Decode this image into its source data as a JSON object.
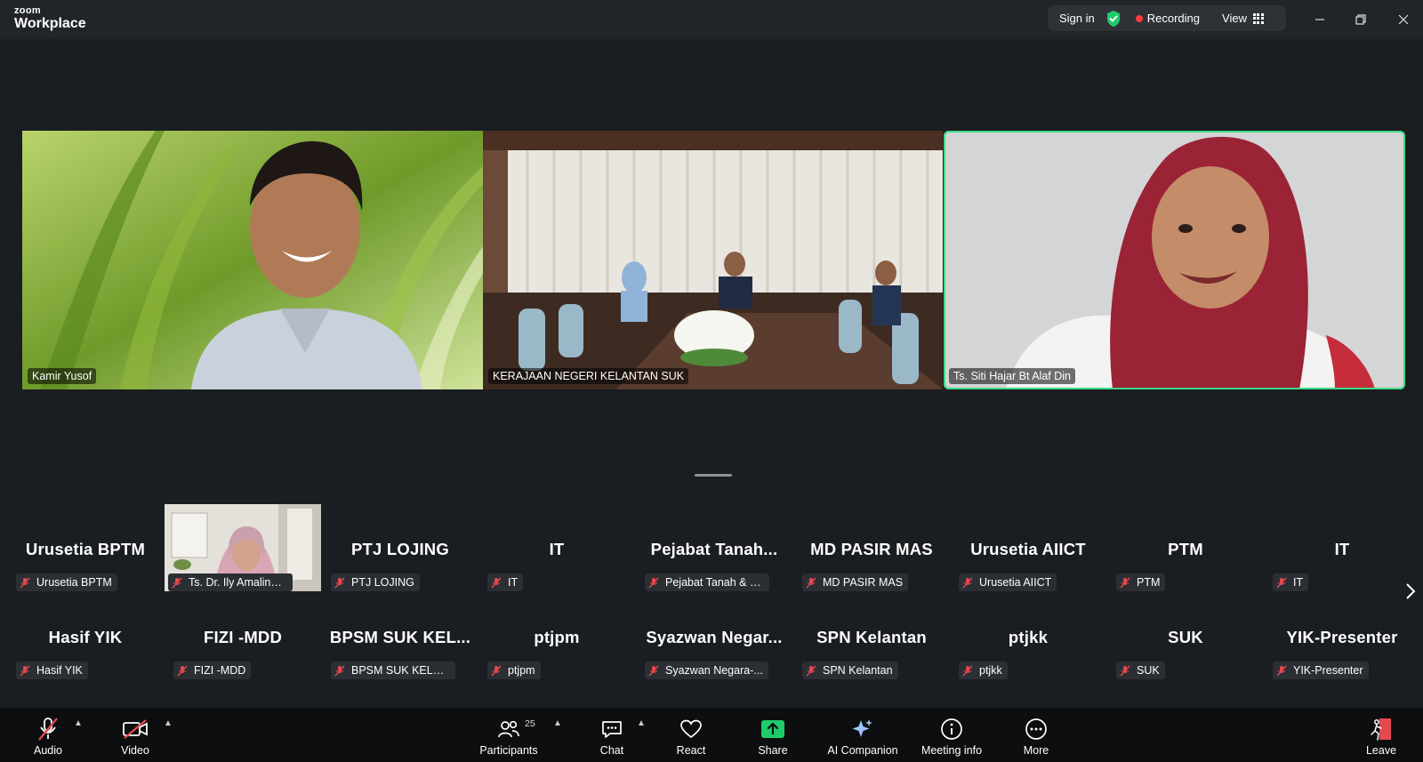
{
  "app": {
    "logo_small": "zoom",
    "logo_big": "Workplace"
  },
  "topbar": {
    "sign_in": "Sign in",
    "recording": "Recording",
    "view": "View"
  },
  "colors": {
    "accent_green": "#3ddc84",
    "record_red": "#ff3b3b",
    "share_green": "#1fcc6a",
    "mute_red": "#e5484d"
  },
  "videos": [
    {
      "name": "Kamir Yusof"
    },
    {
      "name": "KERAJAAN NEGERI KELANTAN SUK"
    },
    {
      "name": "Ts. Siti Hajar Bt Alaf Din"
    }
  ],
  "participants_row1": [
    {
      "big": "Urusetia BPTM",
      "label": "Urusetia BPTM"
    },
    {
      "big": "",
      "label": "Ts. Dr. Ily Amalina ..."
    },
    {
      "big": "PTJ LOJING",
      "label": "PTJ LOJING"
    },
    {
      "big": "IT",
      "label": "IT"
    },
    {
      "big": "Pejabat  Tanah...",
      "label": "Pejabat Tanah & J..."
    },
    {
      "big": "MD PASIR MAS",
      "label": "MD PASIR MAS"
    },
    {
      "big": "Urusetia AIICT",
      "label": "Urusetia AIICT"
    },
    {
      "big": "PTM",
      "label": "PTM"
    },
    {
      "big": "IT",
      "label": "IT"
    }
  ],
  "participants_row2": [
    {
      "big": "Hasif YIK",
      "label": "Hasif YIK"
    },
    {
      "big": "FIZI -MDD",
      "label": "FIZI -MDD"
    },
    {
      "big": "BPSM  SUK KEL...",
      "label": "BPSM SUK KELAN..."
    },
    {
      "big": "ptjpm",
      "label": "ptjpm"
    },
    {
      "big": "Syazwan  Negar...",
      "label": "Syazwan Negara-..."
    },
    {
      "big": "SPN Kelantan",
      "label": "SPN Kelantan"
    },
    {
      "big": "ptjkk",
      "label": "ptjkk"
    },
    {
      "big": "SUK",
      "label": "SUK"
    },
    {
      "big": "YIK-Presenter",
      "label": "YIK-Presenter"
    }
  ],
  "toolbar": {
    "audio": "Audio",
    "video": "Video",
    "participants": "Participants",
    "participants_count": "25",
    "chat": "Chat",
    "react": "React",
    "share": "Share",
    "ai_companion": "AI Companion",
    "meeting_info": "Meeting info",
    "more": "More",
    "leave": "Leave"
  }
}
